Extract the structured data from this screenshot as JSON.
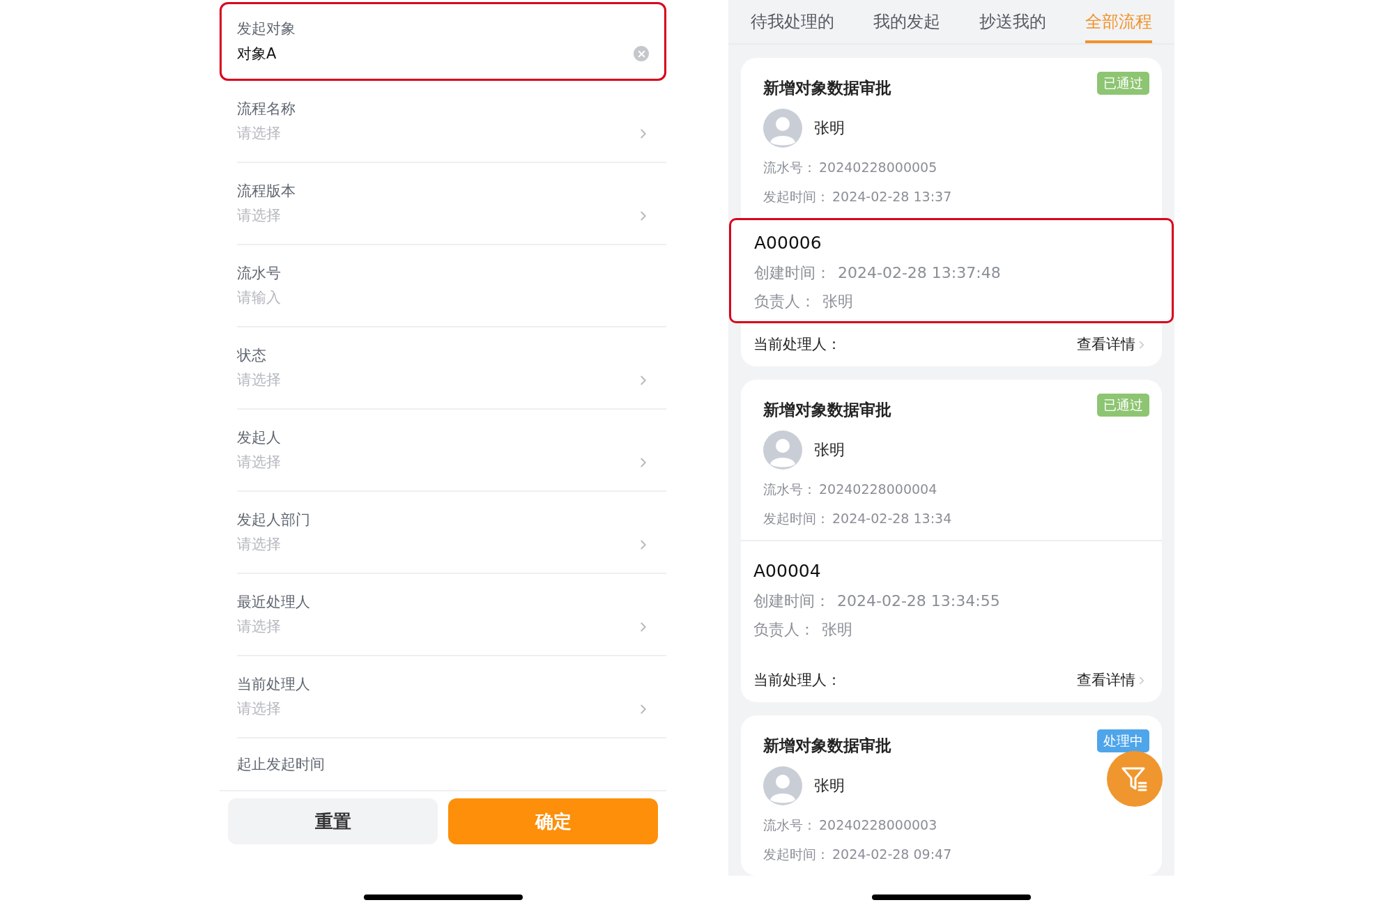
{
  "filter_form": {
    "target_field": {
      "label": "发起对象",
      "value": "对象A",
      "highlighted": true
    },
    "rows": [
      {
        "kind": "select",
        "label": "流程名称",
        "placeholder": "请选择"
      },
      {
        "kind": "select",
        "label": "流程版本",
        "placeholder": "请选择"
      },
      {
        "kind": "input",
        "label": "流水号",
        "placeholder": "请输入"
      },
      {
        "kind": "select",
        "label": "状态",
        "placeholder": "请选择"
      },
      {
        "kind": "select",
        "label": "发起人",
        "placeholder": "请选择"
      },
      {
        "kind": "select",
        "label": "发起人部门",
        "placeholder": "请选择"
      },
      {
        "kind": "select",
        "label": "最近处理人",
        "placeholder": "请选择"
      },
      {
        "kind": "select",
        "label": "当前处理人",
        "placeholder": "请选择"
      },
      {
        "kind": "plain",
        "label": "起止发起时间"
      }
    ],
    "buttons": [
      {
        "kind": "secondary",
        "label": "重置"
      },
      {
        "kind": "primary",
        "label": "确定"
      }
    ]
  },
  "process_list": {
    "tabs": [
      {
        "label": "待我处理的",
        "selected": false
      },
      {
        "label": "我的发起",
        "selected": false
      },
      {
        "label": "抄送我的",
        "selected": false
      },
      {
        "label": "全部流程",
        "selected": true
      }
    ],
    "cards": [
      {
        "title": "新增对象数据审批",
        "status": "已通过",
        "color": "#8dc572",
        "applicant": "张明",
        "serial_label": "流水号：",
        "serial": "20240228000005",
        "time_label": "发起时间：",
        "time": "2024-02-28 13:37",
        "record": {
          "id": "A00006",
          "created_label": "创建时间：",
          "created": "2024-02-28 13:37:48",
          "owner_label": "负责人：",
          "owner": "张明",
          "highlighted": true
        },
        "handler_label": "当前处理人：",
        "details_link": "查看详情"
      },
      {
        "title": "新增对象数据审批",
        "status": "已通过",
        "color": "#8dc572",
        "applicant": "张明",
        "serial_label": "流水号：",
        "serial": "20240228000004",
        "time_label": "发起时间：",
        "time": "2024-02-28 13:34",
        "record": {
          "id": "A00004",
          "created_label": "创建时间：",
          "created": "2024-02-28 13:34:55",
          "owner_label": "负责人：",
          "owner": "张明",
          "highlighted": false
        },
        "handler_label": "当前处理人：",
        "details_link": "查看详情"
      },
      {
        "title": "新增对象数据审批",
        "status": "处理中",
        "color": "#4ea5ea",
        "applicant": "张明",
        "serial_label": "流水号：",
        "serial": "20240228000003",
        "time_label": "发起时间：",
        "time": "2024-02-28 09:47"
      }
    ]
  }
}
